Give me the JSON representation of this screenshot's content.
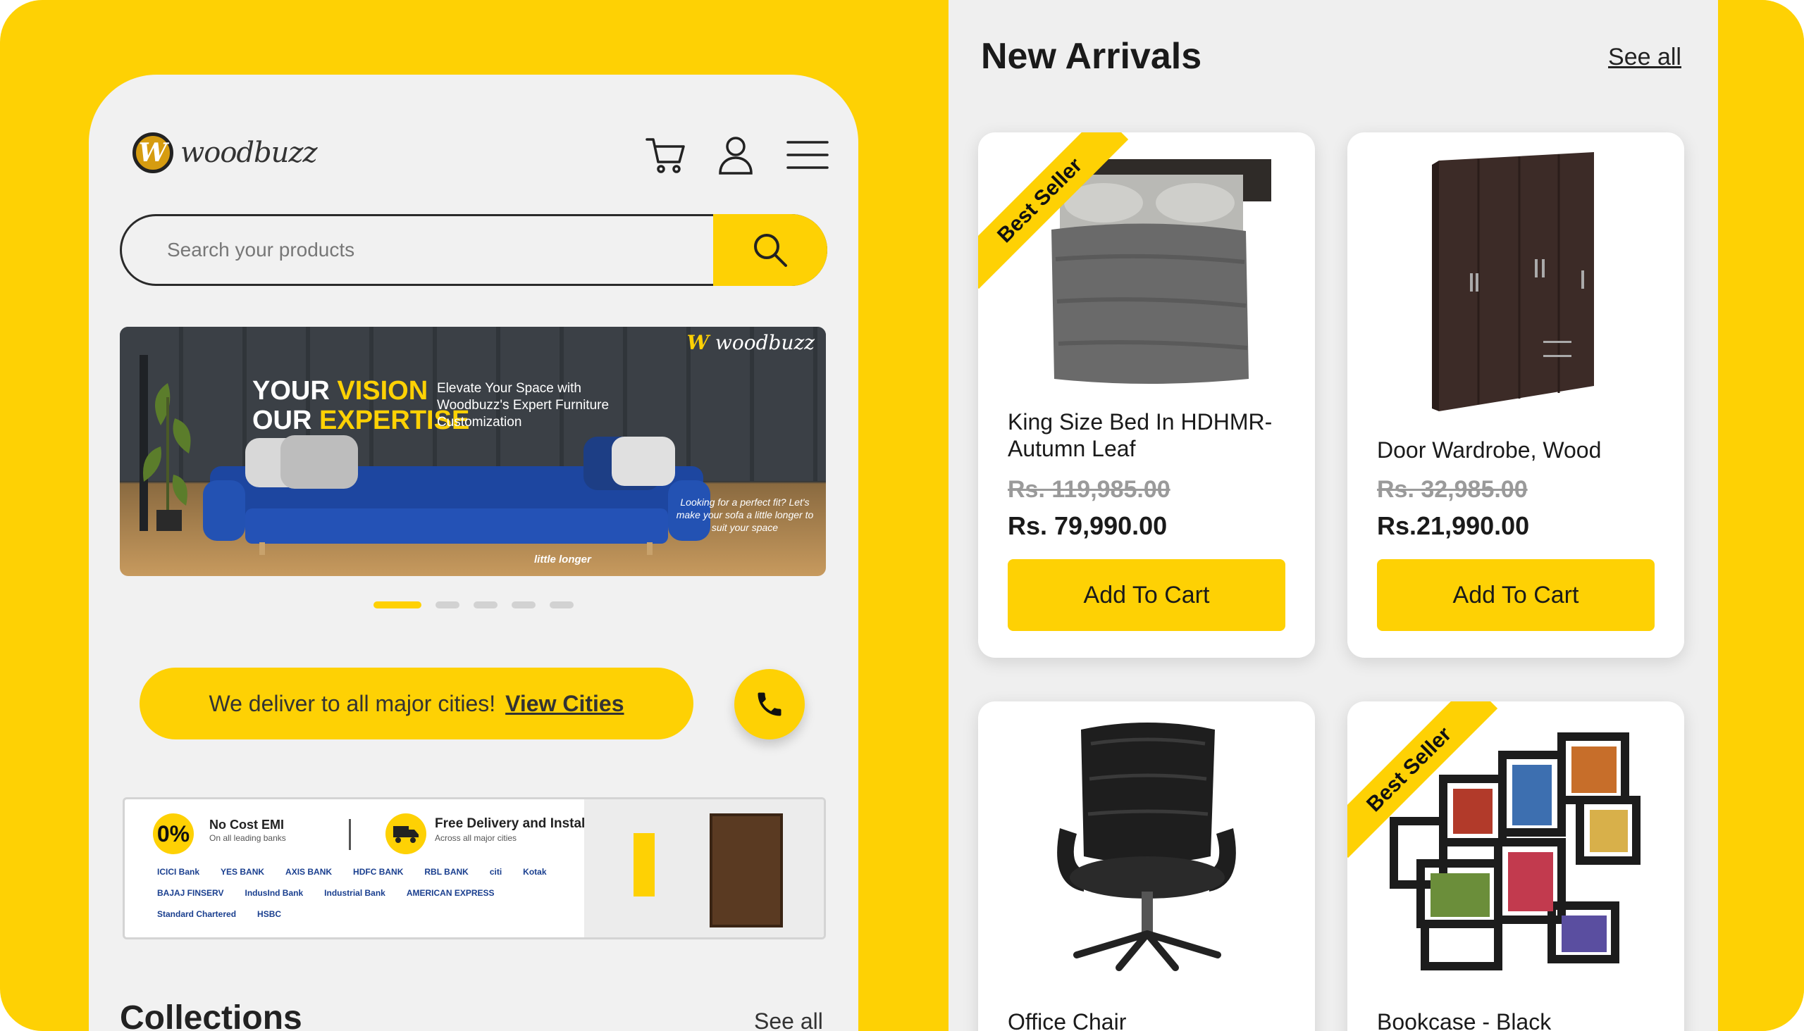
{
  "brand": {
    "name": "woodbuzz",
    "mark": "W"
  },
  "header": {
    "icons": [
      "cart-icon",
      "user-icon",
      "menu-icon"
    ]
  },
  "search": {
    "placeholder": "Search your products"
  },
  "hero_banner": {
    "brand": "woodbuzz",
    "line1_a": "YOUR ",
    "line1_b": "VISION",
    "line2_a": "OUR ",
    "line2_b": "EXPERTISE",
    "subtitle": "Elevate Your Space with Woodbuzz's Expert Furniture Customization",
    "note": "Looking for a perfect fit? Let's make your sofa a little longer to suit your space",
    "length_label": "little longer"
  },
  "carousel": {
    "total": 5,
    "active": 1
  },
  "delivery": {
    "text": "We deliver to all major cities!",
    "link": "View Cities"
  },
  "emi_banner": {
    "zero": "0%",
    "emi_title": "No Cost EMI",
    "emi_sub": "On all leading banks",
    "delivery_title": "Free Delivery and Installation",
    "delivery_sub": "Across all major cities",
    "banks": [
      "ICICI Bank",
      "YES BANK",
      "AXIS BANK",
      "HDFC BANK",
      "RBL BANK",
      "citi",
      "Kotak",
      "BAJAJ FINSERV",
      "IndusInd Bank",
      "Industrial Bank",
      "AMERICAN EXPRESS",
      "Standard Chartered",
      "HSBC"
    ]
  },
  "collections": {
    "title": "Collections",
    "see_all": "See all"
  },
  "new_arrivals": {
    "title": "New Arrivals",
    "see_all": "See all",
    "products": [
      {
        "name": "King Size Bed In HDHMR-Autumn Leaf",
        "old_price": "Rs. 119,985.00",
        "price": "Rs. 79,990.00",
        "button": "Add To Cart",
        "badge": "Best Seller",
        "icon": "bed-image"
      },
      {
        "name": "Door Wardrobe, Wood",
        "old_price": "Rs. 32,985.00",
        "price": "Rs.21,990.00",
        "button": "Add To Cart",
        "badge": "",
        "icon": "wardrobe-image"
      },
      {
        "name": "Office Chair",
        "badge": "",
        "icon": "chair-image"
      },
      {
        "name": "Bookcase - Black",
        "badge": "Best Seller",
        "icon": "bookcase-image"
      }
    ]
  },
  "colors": {
    "accent": "#fed104",
    "panel": "#f1f1f1",
    "text": "#1a1a1a"
  }
}
